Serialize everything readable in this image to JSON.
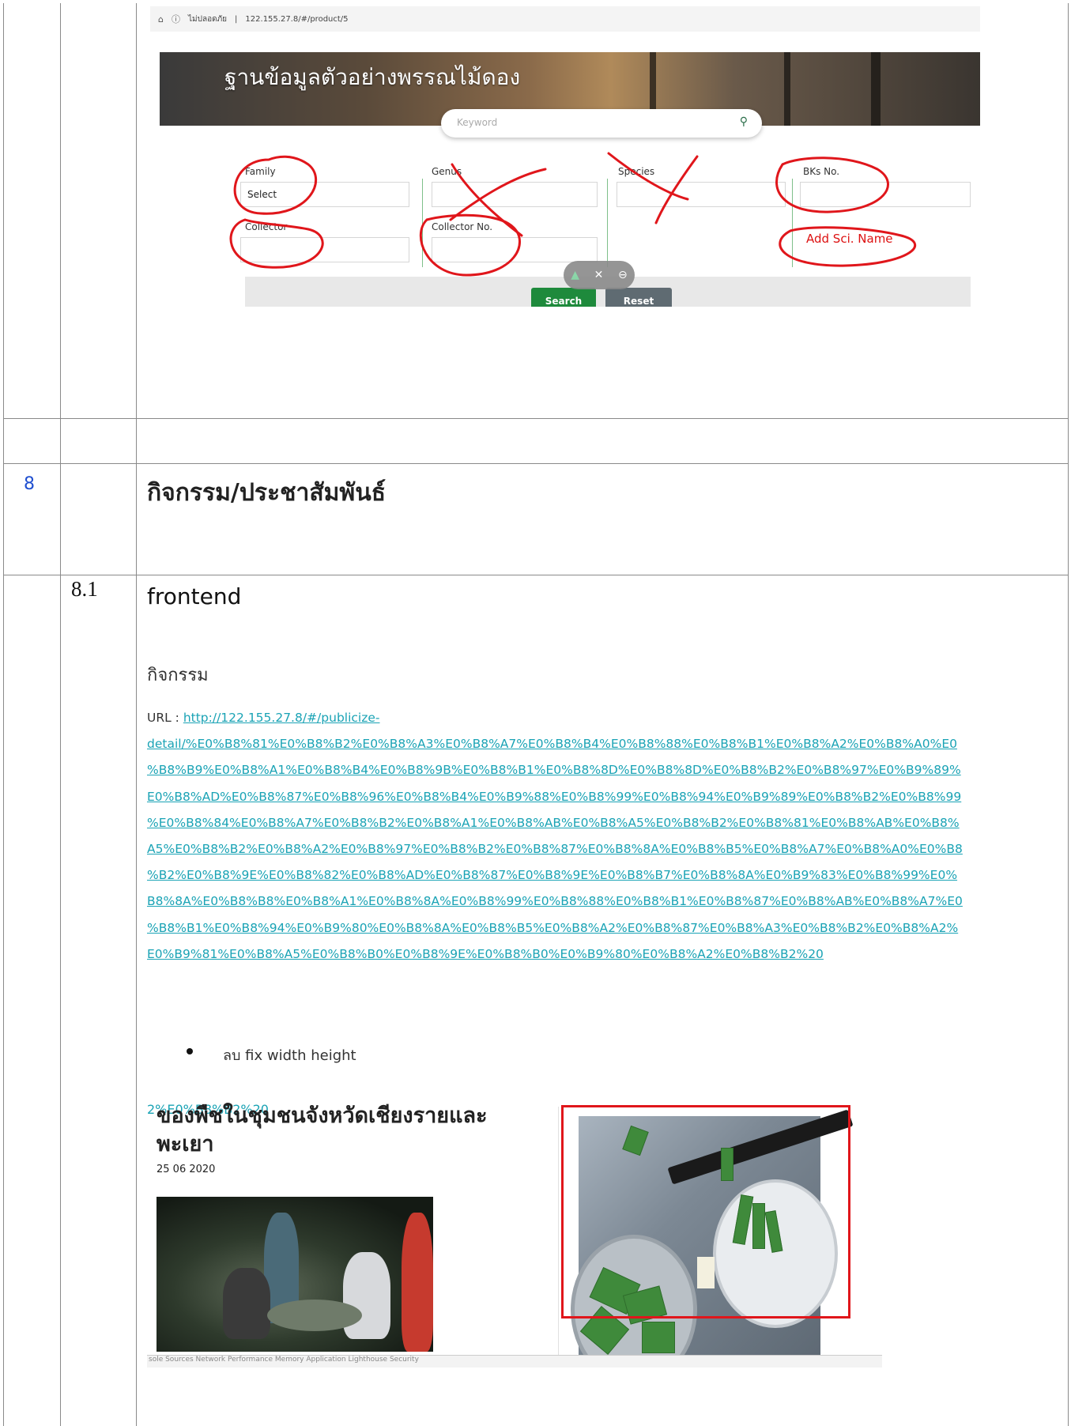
{
  "screenshot1": {
    "address_bar": {
      "security_label": "ไม่ปลอดภัย",
      "url": "122.155.27.8/#/product/5"
    },
    "hero_title": "ฐานข้อมูลตัวอย่างพรรณไม้ดอง",
    "search": {
      "placeholder": "Keyword"
    },
    "fields": {
      "family_label": "Family",
      "family_value": "Select",
      "genus_label": "Genus",
      "species_label": "Species",
      "bks_label": "BKs No.",
      "collector_label": "Collector",
      "collector_no_label": "Collector No."
    },
    "annotation_text": "Add Sci. Name",
    "buttons": {
      "search": "Search",
      "reset": "Reset"
    },
    "annotation_color": "#e0161b"
  },
  "section": {
    "number": "8",
    "title": "กิจกรรม/ประชาสัมพันธ์"
  },
  "subsection": {
    "number": "8.1",
    "title": "frontend",
    "heading": "กิจกรรม",
    "url_label": "URL : ",
    "url_lines": [
      "http://122.155.27.8/#/publicize-",
      "detail/%E0%B8%81%E0%B8%B2%E0%B8%A3%E0%B8%A7%E0%B8%B4%E0%B8%88%E0%B8%B1%E0%B8%A2%E0%B8%A0%E0",
      "%B8%B9%E0%B8%A1%E0%B8%B4%E0%B8%9B%E0%B8%B1%E0%B8%8D%E0%B8%8D%E0%B8%B2%E0%B8%97%E0%B9%89%",
      "E0%B8%AD%E0%B8%87%E0%B8%96%E0%B8%B4%E0%B9%88%E0%B8%99%E0%B8%94%E0%B9%89%E0%B8%B2%E0%B8%99",
      "%E0%B8%84%E0%B8%A7%E0%B8%B2%E0%B8%A1%E0%B8%AB%E0%B8%A5%E0%B8%B2%E0%B8%81%E0%B8%AB%E0%B8%",
      "A5%E0%B8%B2%E0%B8%A2%E0%B8%97%E0%B8%B2%E0%B8%87%E0%B8%8A%E0%B8%B5%E0%B8%A7%E0%B8%A0%E0%B8",
      "%B2%E0%B8%9E%E0%B8%82%E0%B8%AD%E0%B8%87%E0%B8%9E%E0%B8%B7%E0%B8%8A%E0%B9%83%E0%B8%99%E0%",
      "B8%8A%E0%B8%B8%E0%B8%A1%E0%B8%8A%E0%B8%99%E0%B8%88%E0%B8%B1%E0%B8%87%E0%B8%AB%E0%B8%A7%E0",
      "%B8%B1%E0%B8%94%E0%B9%80%E0%B8%8A%E0%B8%B5%E0%B8%A2%E0%B8%87%E0%B8%A3%E0%B8%B2%E0%B8%A2%",
      "E0%B9%81%E0%B8%A5%E0%B8%B0%E0%B8%9E%E0%B8%B0%E0%B9%80%E0%B8%A2%E0%B8%B2%20"
    ],
    "bullet": "ลบ fix width height",
    "url_color": "#1aa3b5"
  },
  "screenshot2": {
    "overlap_text": "2%E0%B8%B2%20",
    "article_title": "ของพืชในชุมชนจังหวัดเชียงรายและ พะเยา",
    "article_date": "25 06 2020",
    "devtools_tabs": "sole   Sources   Network   Performance   Memory   Application   Lighthouse   Security"
  }
}
